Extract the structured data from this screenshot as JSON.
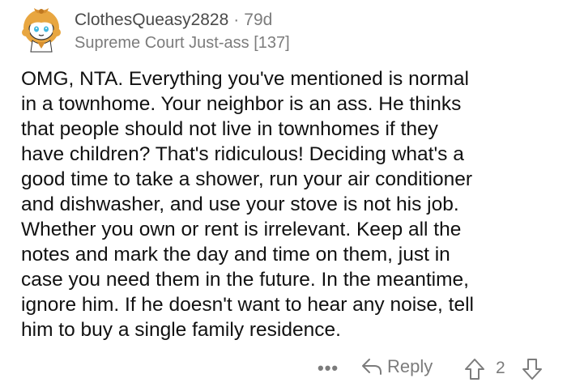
{
  "comment": {
    "username": "ClothesQueasy2828",
    "separator": "·",
    "age": "79d",
    "flair": "Supreme Court Just-ass [137]",
    "body": "OMG, NTA.  Everything you've mentioned is normal\nin a townhome.  Your neighbor is an ass.  He thinks\nthat people should not live in townhomes if they\nhave children?  That's ridiculous!  Deciding what's a\ngood time to take a shower, run your air conditioner\nand dishwasher, and use your stove is not his job.\nWhether you own or rent is irrelevant.  Keep all the\nnotes and mark the day and time on them, just in\ncase you need them in the future.  In the meantime,\nignore him.  If he doesn't want to hear any noise, tell\nhim to buy a single family residence."
  },
  "actions": {
    "more_label": "•••",
    "reply_label": "Reply",
    "vote_count": "2"
  },
  "icons": {
    "avatar": "snoo-avatar-icon",
    "reply": "reply-arrow-icon",
    "upvote": "upvote-arrow-icon",
    "downvote": "downvote-arrow-icon"
  },
  "colors": {
    "text": "#111111",
    "meta": "#7c7c7c",
    "avatar_hair": "#e8a640"
  }
}
